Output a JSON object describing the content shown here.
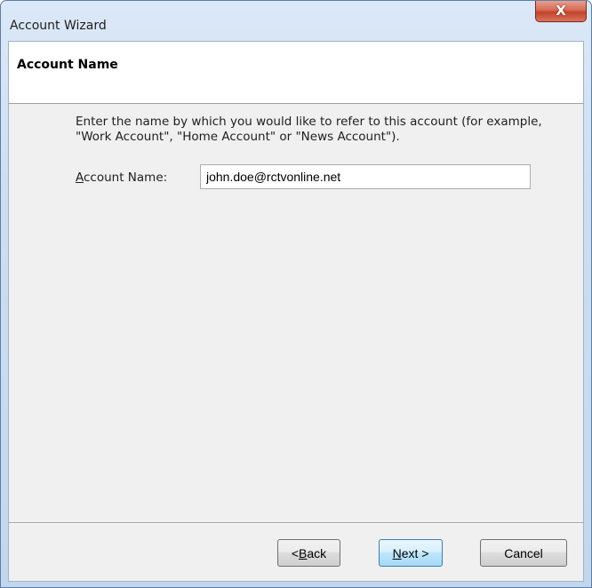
{
  "window": {
    "title": "Account Wizard",
    "close_glyph": "X"
  },
  "page": {
    "header_title": "Account Name",
    "description": "Enter the name by which you would like to refer to this account (for example, \"Work Account\", \"Home Account\" or \"News Account\").",
    "field": {
      "label_accel": "A",
      "label_rest": "ccount Name:",
      "value": "john.doe@rctvonline.net"
    }
  },
  "buttons": {
    "back": {
      "prefix": "< ",
      "accel": "B",
      "rest": "ack"
    },
    "next": {
      "accel": "N",
      "rest": "ext >"
    },
    "cancel": {
      "label": "Cancel"
    }
  },
  "colors": {
    "title_bar": "#cfdff1",
    "close_button": "#c2432b",
    "focused_button": "#3c7fb1"
  }
}
